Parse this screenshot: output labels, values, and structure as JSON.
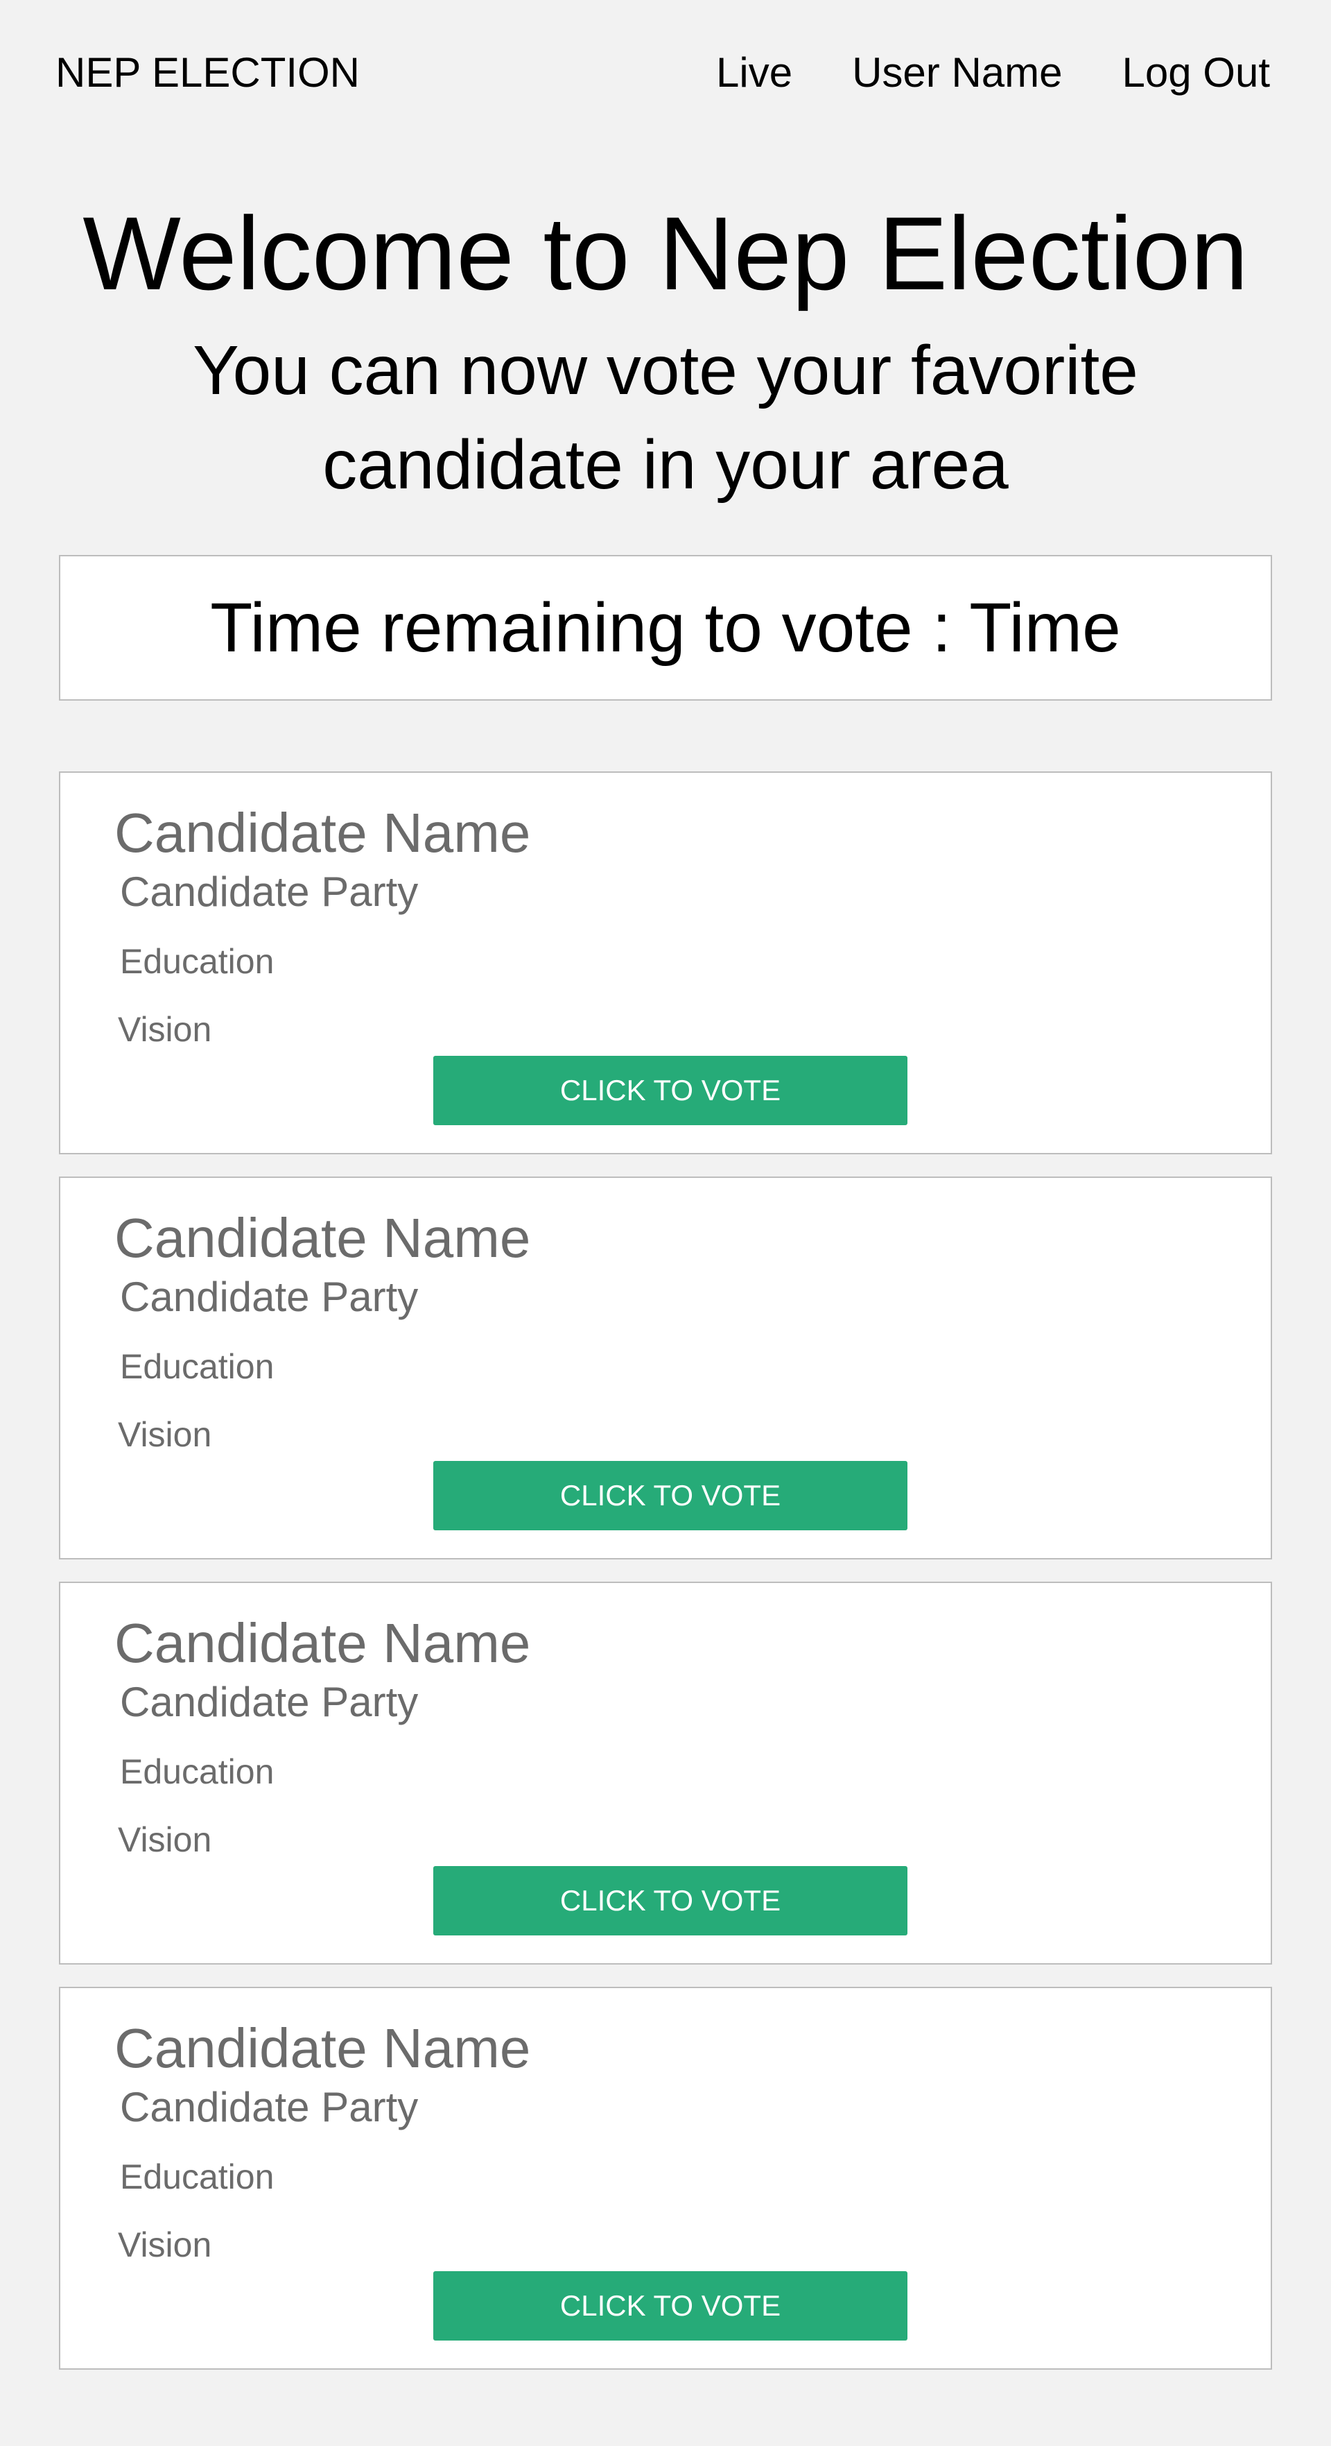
{
  "nav": {
    "brand": "NEP ELECTION",
    "live": "Live",
    "user": "User Name",
    "logout": "Log Out"
  },
  "hero": {
    "title": "Welcome to Nep Election",
    "subtitle": "You can now vote your favorite candidate in your area"
  },
  "timer": {
    "text": "Time remaining to vote : Time"
  },
  "candidates": [
    {
      "name": "Candidate Name",
      "party": "Candidate Party",
      "education": "Education",
      "vision": "Vision",
      "button": "CLICK TO VOTE"
    },
    {
      "name": "Candidate Name",
      "party": "Candidate Party",
      "education": "Education",
      "vision": "Vision",
      "button": "CLICK TO VOTE"
    },
    {
      "name": "Candidate Name",
      "party": "Candidate Party",
      "education": "Education",
      "vision": "Vision",
      "button": "CLICK TO VOTE"
    },
    {
      "name": "Candidate Name",
      "party": "Candidate Party",
      "education": "Education",
      "vision": "Vision",
      "button": "CLICK TO VOTE"
    }
  ],
  "colors": {
    "background": "#f2f2f2",
    "card": "#ffffff",
    "border": "#bdbdbd",
    "muted_text": "#6b6b6b",
    "vote_button": "#26ab78",
    "vote_button_text": "#ffffff"
  }
}
